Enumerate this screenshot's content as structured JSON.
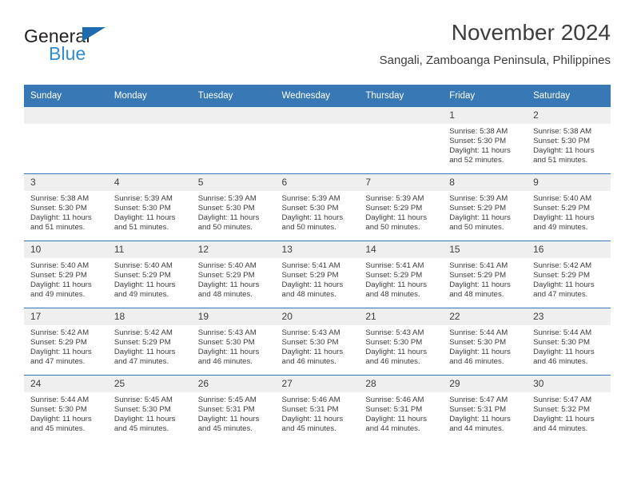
{
  "brand": {
    "name_dark": "General",
    "name_blue": "Blue",
    "color_dark": "#231f20",
    "color_blue": "#2e8bd4",
    "triangle_color": "#1f6bb0"
  },
  "header": {
    "title": "November 2024",
    "subtitle": "Sangali, Zamboanga Peninsula, Philippines"
  },
  "theme": {
    "header_row_bg": "#3878b4",
    "header_row_text": "#ffffff",
    "daynum_bg": "#efefef",
    "cell_text": "#3d3d3d",
    "row_divider": "#3878b4"
  },
  "weekdays": [
    "Sunday",
    "Monday",
    "Tuesday",
    "Wednesday",
    "Thursday",
    "Friday",
    "Saturday"
  ],
  "labels": {
    "sunrise_prefix": "Sunrise:",
    "sunset_prefix": "Sunset:",
    "daylight_prefix": "Daylight:"
  },
  "weeks": [
    [
      {
        "day": "",
        "lines": []
      },
      {
        "day": "",
        "lines": []
      },
      {
        "day": "",
        "lines": []
      },
      {
        "day": "",
        "lines": []
      },
      {
        "day": "",
        "lines": []
      },
      {
        "day": "1",
        "lines": [
          "Sunrise: 5:38 AM",
          "Sunset: 5:30 PM",
          "Daylight: 11 hours",
          "and 52 minutes."
        ]
      },
      {
        "day": "2",
        "lines": [
          "Sunrise: 5:38 AM",
          "Sunset: 5:30 PM",
          "Daylight: 11 hours",
          "and 51 minutes."
        ]
      }
    ],
    [
      {
        "day": "3",
        "lines": [
          "Sunrise: 5:38 AM",
          "Sunset: 5:30 PM",
          "Daylight: 11 hours",
          "and 51 minutes."
        ]
      },
      {
        "day": "4",
        "lines": [
          "Sunrise: 5:39 AM",
          "Sunset: 5:30 PM",
          "Daylight: 11 hours",
          "and 51 minutes."
        ]
      },
      {
        "day": "5",
        "lines": [
          "Sunrise: 5:39 AM",
          "Sunset: 5:30 PM",
          "Daylight: 11 hours",
          "and 50 minutes."
        ]
      },
      {
        "day": "6",
        "lines": [
          "Sunrise: 5:39 AM",
          "Sunset: 5:30 PM",
          "Daylight: 11 hours",
          "and 50 minutes."
        ]
      },
      {
        "day": "7",
        "lines": [
          "Sunrise: 5:39 AM",
          "Sunset: 5:29 PM",
          "Daylight: 11 hours",
          "and 50 minutes."
        ]
      },
      {
        "day": "8",
        "lines": [
          "Sunrise: 5:39 AM",
          "Sunset: 5:29 PM",
          "Daylight: 11 hours",
          "and 50 minutes."
        ]
      },
      {
        "day": "9",
        "lines": [
          "Sunrise: 5:40 AM",
          "Sunset: 5:29 PM",
          "Daylight: 11 hours",
          "and 49 minutes."
        ]
      }
    ],
    [
      {
        "day": "10",
        "lines": [
          "Sunrise: 5:40 AM",
          "Sunset: 5:29 PM",
          "Daylight: 11 hours",
          "and 49 minutes."
        ]
      },
      {
        "day": "11",
        "lines": [
          "Sunrise: 5:40 AM",
          "Sunset: 5:29 PM",
          "Daylight: 11 hours",
          "and 49 minutes."
        ]
      },
      {
        "day": "12",
        "lines": [
          "Sunrise: 5:40 AM",
          "Sunset: 5:29 PM",
          "Daylight: 11 hours",
          "and 48 minutes."
        ]
      },
      {
        "day": "13",
        "lines": [
          "Sunrise: 5:41 AM",
          "Sunset: 5:29 PM",
          "Daylight: 11 hours",
          "and 48 minutes."
        ]
      },
      {
        "day": "14",
        "lines": [
          "Sunrise: 5:41 AM",
          "Sunset: 5:29 PM",
          "Daylight: 11 hours",
          "and 48 minutes."
        ]
      },
      {
        "day": "15",
        "lines": [
          "Sunrise: 5:41 AM",
          "Sunset: 5:29 PM",
          "Daylight: 11 hours",
          "and 48 minutes."
        ]
      },
      {
        "day": "16",
        "lines": [
          "Sunrise: 5:42 AM",
          "Sunset: 5:29 PM",
          "Daylight: 11 hours",
          "and 47 minutes."
        ]
      }
    ],
    [
      {
        "day": "17",
        "lines": [
          "Sunrise: 5:42 AM",
          "Sunset: 5:29 PM",
          "Daylight: 11 hours",
          "and 47 minutes."
        ]
      },
      {
        "day": "18",
        "lines": [
          "Sunrise: 5:42 AM",
          "Sunset: 5:29 PM",
          "Daylight: 11 hours",
          "and 47 minutes."
        ]
      },
      {
        "day": "19",
        "lines": [
          "Sunrise: 5:43 AM",
          "Sunset: 5:30 PM",
          "Daylight: 11 hours",
          "and 46 minutes."
        ]
      },
      {
        "day": "20",
        "lines": [
          "Sunrise: 5:43 AM",
          "Sunset: 5:30 PM",
          "Daylight: 11 hours",
          "and 46 minutes."
        ]
      },
      {
        "day": "21",
        "lines": [
          "Sunrise: 5:43 AM",
          "Sunset: 5:30 PM",
          "Daylight: 11 hours",
          "and 46 minutes."
        ]
      },
      {
        "day": "22",
        "lines": [
          "Sunrise: 5:44 AM",
          "Sunset: 5:30 PM",
          "Daylight: 11 hours",
          "and 46 minutes."
        ]
      },
      {
        "day": "23",
        "lines": [
          "Sunrise: 5:44 AM",
          "Sunset: 5:30 PM",
          "Daylight: 11 hours",
          "and 46 minutes."
        ]
      }
    ],
    [
      {
        "day": "24",
        "lines": [
          "Sunrise: 5:44 AM",
          "Sunset: 5:30 PM",
          "Daylight: 11 hours",
          "and 45 minutes."
        ]
      },
      {
        "day": "25",
        "lines": [
          "Sunrise: 5:45 AM",
          "Sunset: 5:30 PM",
          "Daylight: 11 hours",
          "and 45 minutes."
        ]
      },
      {
        "day": "26",
        "lines": [
          "Sunrise: 5:45 AM",
          "Sunset: 5:31 PM",
          "Daylight: 11 hours",
          "and 45 minutes."
        ]
      },
      {
        "day": "27",
        "lines": [
          "Sunrise: 5:46 AM",
          "Sunset: 5:31 PM",
          "Daylight: 11 hours",
          "and 45 minutes."
        ]
      },
      {
        "day": "28",
        "lines": [
          "Sunrise: 5:46 AM",
          "Sunset: 5:31 PM",
          "Daylight: 11 hours",
          "and 44 minutes."
        ]
      },
      {
        "day": "29",
        "lines": [
          "Sunrise: 5:47 AM",
          "Sunset: 5:31 PM",
          "Daylight: 11 hours",
          "and 44 minutes."
        ]
      },
      {
        "day": "30",
        "lines": [
          "Sunrise: 5:47 AM",
          "Sunset: 5:32 PM",
          "Daylight: 11 hours",
          "and 44 minutes."
        ]
      }
    ]
  ]
}
